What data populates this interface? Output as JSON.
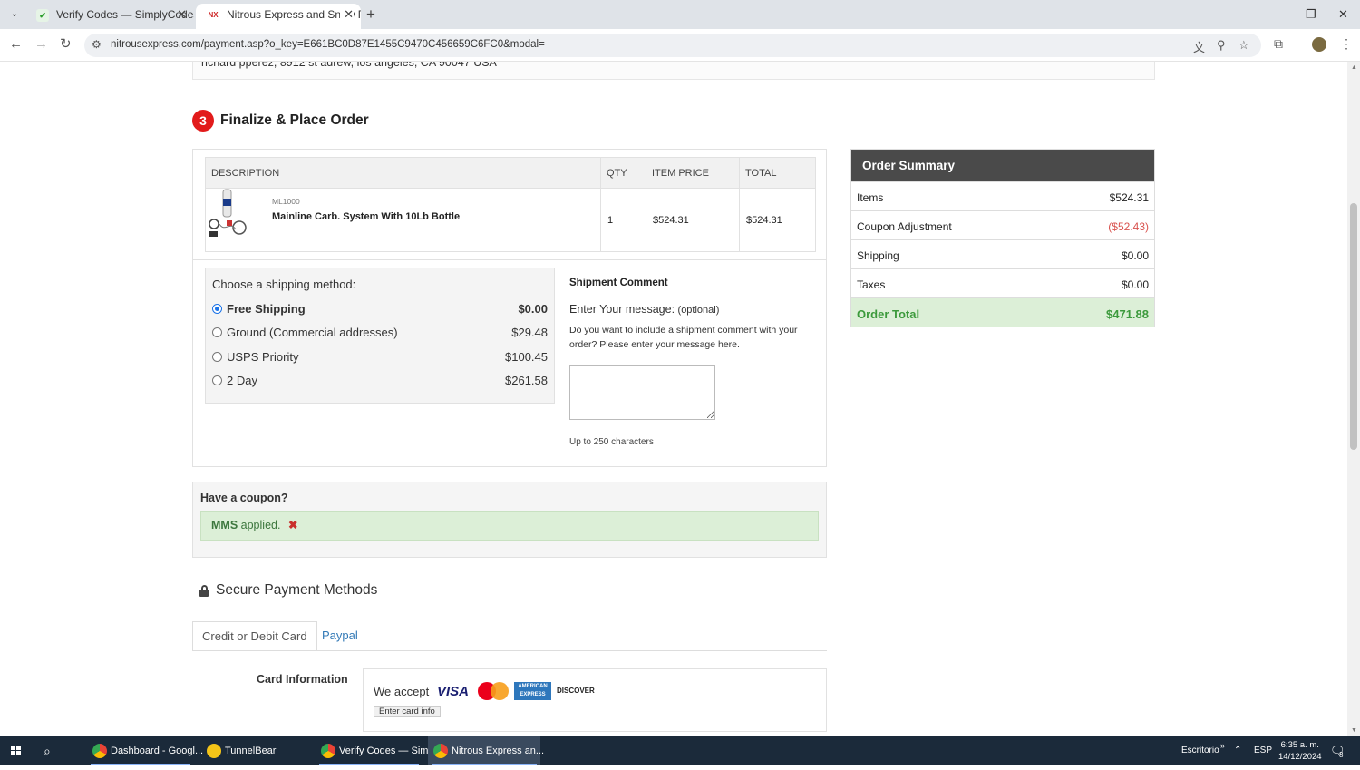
{
  "browser": {
    "tabs": [
      {
        "title": "Verify Codes — SimplyCodes",
        "active": false
      },
      {
        "title": "Nitrous Express and Snow Perfo",
        "active": true
      }
    ],
    "url": "nitrousexpress.com/payment.asp?o_key=E661BC0D87E1455C9470C456659C6FC0&modal="
  },
  "page": {
    "address_line": "richard pperez, 8912 st adrew, los angeles, CA 90047 USA",
    "step_number": "3",
    "step_title": "Finalize & Place Order",
    "item_table": {
      "headers": [
        "DESCRIPTION",
        "QTY",
        "ITEM PRICE",
        "TOTAL"
      ],
      "rows": [
        {
          "sku": "ML1000",
          "name": "Mainline Carb. System With 10Lb Bottle",
          "qty": "1",
          "price": "$524.31",
          "total": "$524.31"
        }
      ]
    },
    "shipping": {
      "header": "Choose a shipping method:",
      "options": [
        {
          "label": "Free Shipping",
          "price": "$0.00",
          "selected": true
        },
        {
          "label": "Ground (Commercial addresses)",
          "price": "$29.48",
          "selected": false
        },
        {
          "label": "USPS Priority",
          "price": "$100.45",
          "selected": false
        },
        {
          "label": "2 Day",
          "price": "$261.58",
          "selected": false
        }
      ]
    },
    "comment": {
      "title": "Shipment Comment",
      "message_label": "Enter Your message:",
      "optional": "(optional)",
      "description": "Do you want to include a shipment comment with your order? Please enter your message here.",
      "limit": "Up to 250 characters"
    },
    "coupon": {
      "title": "Have a coupon?",
      "code": "MMS",
      "status": "applied."
    },
    "payment": {
      "title": "Secure Payment Methods",
      "tabs": [
        "Credit or Debit Card",
        "Paypal"
      ],
      "card_label": "Card Information",
      "we_accept": "We accept",
      "visa": "VISA",
      "amex": "AMERICAN EXPRESS",
      "discover": "DISCOVER",
      "enter_card": "Enter card info"
    },
    "summary": {
      "title": "Order Summary",
      "rows": [
        {
          "label": "Items",
          "value": "$524.31"
        },
        {
          "label": "Coupon Adjustment",
          "value": "($52.43)"
        },
        {
          "label": "Shipping",
          "value": "$0.00"
        },
        {
          "label": "Taxes",
          "value": "$0.00"
        }
      ],
      "total_label": "Order Total",
      "total_value": "$471.88"
    }
  },
  "taskbar": {
    "apps": [
      "Dashboard - Googl...",
      "TunnelBear",
      "Verify Codes — Sim...",
      "Nitrous Express an..."
    ],
    "desktop": "Escritorio",
    "lang": "ESP",
    "time": "6:35 a. m.",
    "date": "14/12/2024",
    "notif_count": "8"
  },
  "colors": {
    "step_badge": "#e21b1b",
    "summary_header": "#4a4a4a",
    "success_bg": "#dcefd7",
    "success_text": "#3c9a3c",
    "negative": "#d9534f",
    "link": "#337ab7"
  }
}
